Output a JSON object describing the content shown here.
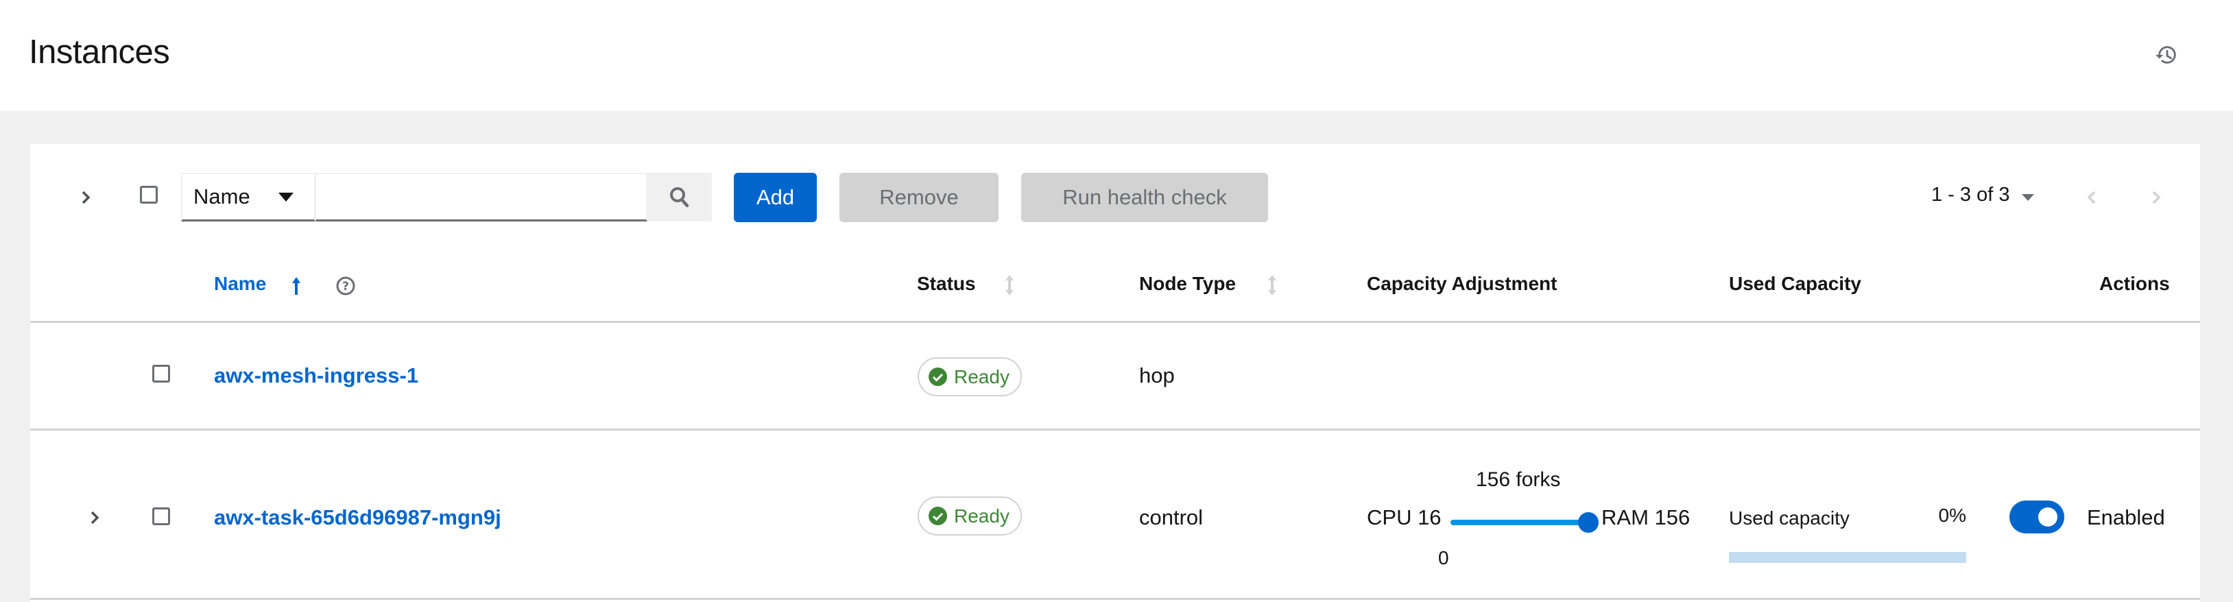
{
  "header": {
    "title": "Instances",
    "history_icon": "history-icon"
  },
  "toolbar": {
    "filter_select_value": "Name",
    "search_placeholder": "",
    "search_value": "",
    "add_label": "Add",
    "remove_label": "Remove",
    "health_check_label": "Run health check",
    "pagination_text": "1 - 3 of 3"
  },
  "table": {
    "columns": [
      {
        "label": "Name",
        "sorted": "ascending",
        "help": true
      },
      {
        "label": "Status",
        "sortable": true
      },
      {
        "label": "Node Type",
        "sortable": true
      },
      {
        "label": "Capacity Adjustment"
      },
      {
        "label": "Used Capacity"
      },
      {
        "label": "Actions"
      }
    ],
    "rows": [
      {
        "name": "awx-mesh-ingress-1",
        "status": "Ready",
        "node_type": "hop",
        "expandable": false
      },
      {
        "name": "awx-task-65d6d96987-mgn9j",
        "status": "Ready",
        "node_type": "control",
        "expandable": true,
        "capacity": {
          "forks_label": "156 forks",
          "cpu_label": "CPU 16",
          "ram_label": "RAM 156",
          "min_label": "0",
          "slider_fraction": 1.0
        },
        "used_capacity": {
          "label": "Used capacity",
          "percent_label": "0%",
          "percent": 0
        },
        "enabled": true,
        "enabled_label": "Enabled"
      }
    ]
  },
  "colors": {
    "primary": "#0066cc",
    "success": "#3e8635",
    "slider": "#0094e6",
    "progress_bg": "#c3dcf0"
  }
}
